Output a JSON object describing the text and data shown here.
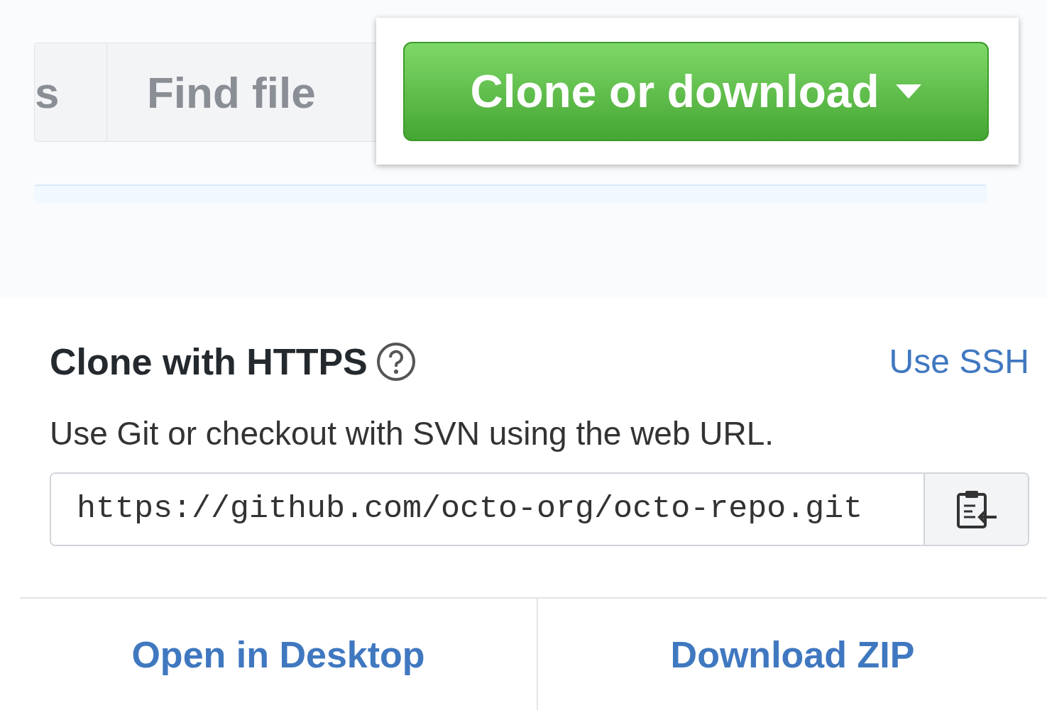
{
  "toolbar": {
    "partial_button": "s",
    "find_file": "Find file",
    "clone_button": "Clone or download"
  },
  "panel": {
    "title": "Clone with HTTPS",
    "switch_link": "Use SSH",
    "description": "Use Git or checkout with SVN using the web URL.",
    "url": "https://github.com/octo-org/octo-repo.git"
  },
  "actions": [
    "Open in Desktop",
    "Download ZIP"
  ]
}
